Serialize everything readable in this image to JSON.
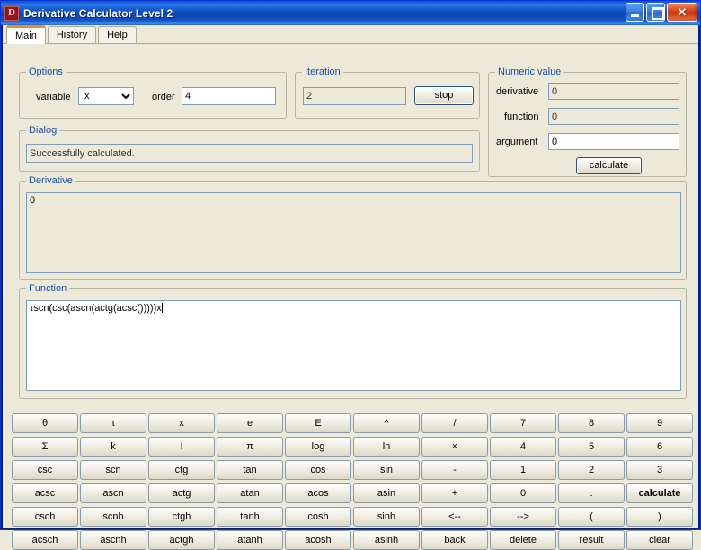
{
  "window": {
    "title": "Derivative Calculator Level 2",
    "icon": "app-icon",
    "minimize_label": "_",
    "maximize_label": "□",
    "close_label": "✕"
  },
  "tabs": [
    {
      "label": "Main",
      "active": true
    },
    {
      "label": "History",
      "active": false
    },
    {
      "label": "Help",
      "active": false
    }
  ],
  "options": {
    "legend": "Options",
    "variable_label": "variable",
    "variable_value": "x",
    "variable_options": [
      "x"
    ],
    "order_label": "order",
    "order_value": "4"
  },
  "iteration": {
    "legend": "Iteration",
    "value": "2",
    "stop_label": "stop"
  },
  "numeric": {
    "legend": "Numeric value",
    "derivative_label": "derivative",
    "derivative_value": "0",
    "function_label": "function",
    "function_value": "0",
    "argument_label": "argument",
    "argument_value": "0",
    "calculate_label": "calculate"
  },
  "dialog": {
    "legend": "Dialog",
    "message": "Successfully calculated."
  },
  "derivative": {
    "legend": "Derivative",
    "text": "0"
  },
  "function": {
    "legend": "Function",
    "text": "τscn(csc(ascn(actg(acsc()))))x"
  },
  "keypad": {
    "keys": [
      "θ",
      "τ",
      "x",
      "e",
      "E",
      "^",
      "/",
      "7",
      "8",
      "9",
      "Σ",
      "k",
      "!",
      "π",
      "log",
      "ln",
      "×",
      "4",
      "5",
      "6",
      "csc",
      "scn",
      "ctg",
      "tan",
      "cos",
      "sin",
      "-",
      "1",
      "2",
      "3",
      "acsc",
      "ascn",
      "actg",
      "atan",
      "acos",
      "asin",
      "+",
      "0",
      ".",
      "calculate",
      "csch",
      "scnh",
      "ctgh",
      "tanh",
      "cosh",
      "sinh",
      "<--",
      "-->",
      "(",
      ")",
      "acsch",
      "ascnh",
      "actgh",
      "atanh",
      "acosh",
      "asinh",
      "back",
      "delete",
      "result",
      "clear"
    ],
    "bold_keys": [
      "calculate"
    ]
  },
  "colors": {
    "titlebar_blue": "#0b55c4",
    "legend_blue": "#1a4fa0",
    "active_tab_accent": "#f08c20",
    "face": "#ece9d8",
    "field_border": "#7f9db9",
    "close_red": "#c7340f"
  }
}
